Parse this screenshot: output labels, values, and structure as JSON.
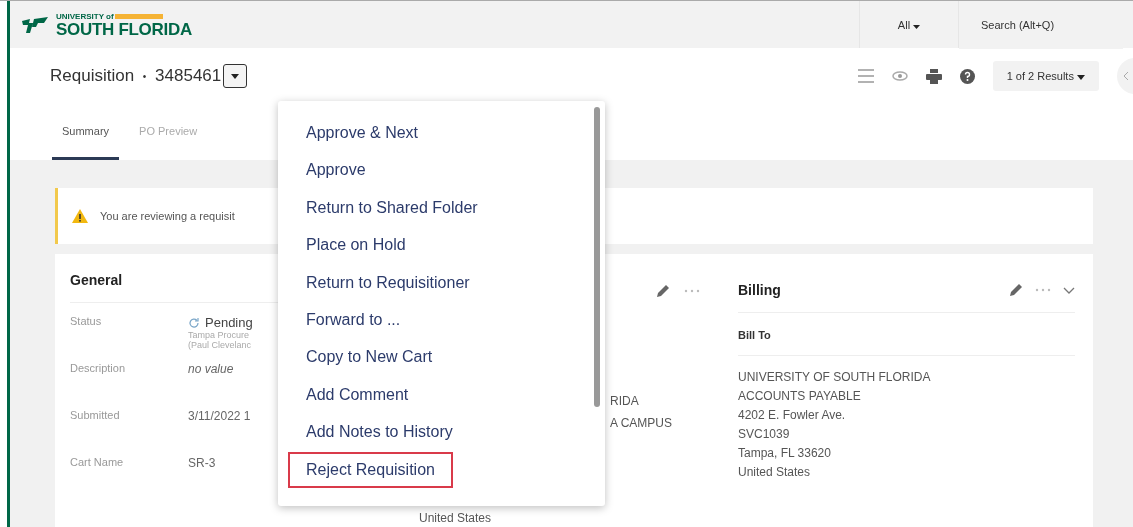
{
  "topbar": {
    "logo_small": "UNIVERSITY of",
    "logo": "SOUTH FLORIDA",
    "scope": "All",
    "search": {
      "placeholder": "Search (Alt+Q)"
    }
  },
  "header": {
    "title": "Requisition",
    "separator": "•",
    "number": "3485461",
    "results": "1 of 2 Results"
  },
  "tabs": [
    {
      "label": "Summary",
      "selected": true
    },
    {
      "label": "PO Preview",
      "selected": false
    }
  ],
  "notice": "You are reviewing a requisit",
  "general": {
    "title": "General",
    "fields": [
      {
        "label": "Status",
        "value": "Pending",
        "kind": "status",
        "notes": [
          "Tampa Procure",
          "(Paul Clevelanc"
        ]
      },
      {
        "label": "Description",
        "value": "no value",
        "kind": "empty"
      },
      {
        "label": "Submitted",
        "value": "3/11/2022 1",
        "kind": "text"
      },
      {
        "label": "Cart Name",
        "value": "SR-3",
        "kind": "text"
      }
    ]
  },
  "shipping": {
    "lines": [
      "RIDA",
      "A CAMPUS"
    ],
    "country": "United States"
  },
  "billing": {
    "title": "Billing",
    "subtitle": "Bill To",
    "lines": [
      "UNIVERSITY OF SOUTH FLORIDA",
      "ACCOUNTS PAYABLE",
      "4202 E. Fowler Ave.",
      "SVC1039",
      "Tampa, FL 33620",
      "United States"
    ]
  },
  "menu": [
    {
      "label": "Approve & Next",
      "selected": false
    },
    {
      "label": "Approve",
      "selected": false
    },
    {
      "label": "Return to Shared Folder",
      "selected": false
    },
    {
      "label": "Place on Hold",
      "selected": false
    },
    {
      "label": "Return to Requisitioner",
      "selected": false
    },
    {
      "label": "Forward to ...",
      "selected": false
    },
    {
      "label": "Copy to New Cart",
      "selected": false
    },
    {
      "label": "Add Comment",
      "selected": false
    },
    {
      "label": "Add Notes to History",
      "selected": false
    },
    {
      "label": "Reject Requisition",
      "selected": true
    }
  ]
}
